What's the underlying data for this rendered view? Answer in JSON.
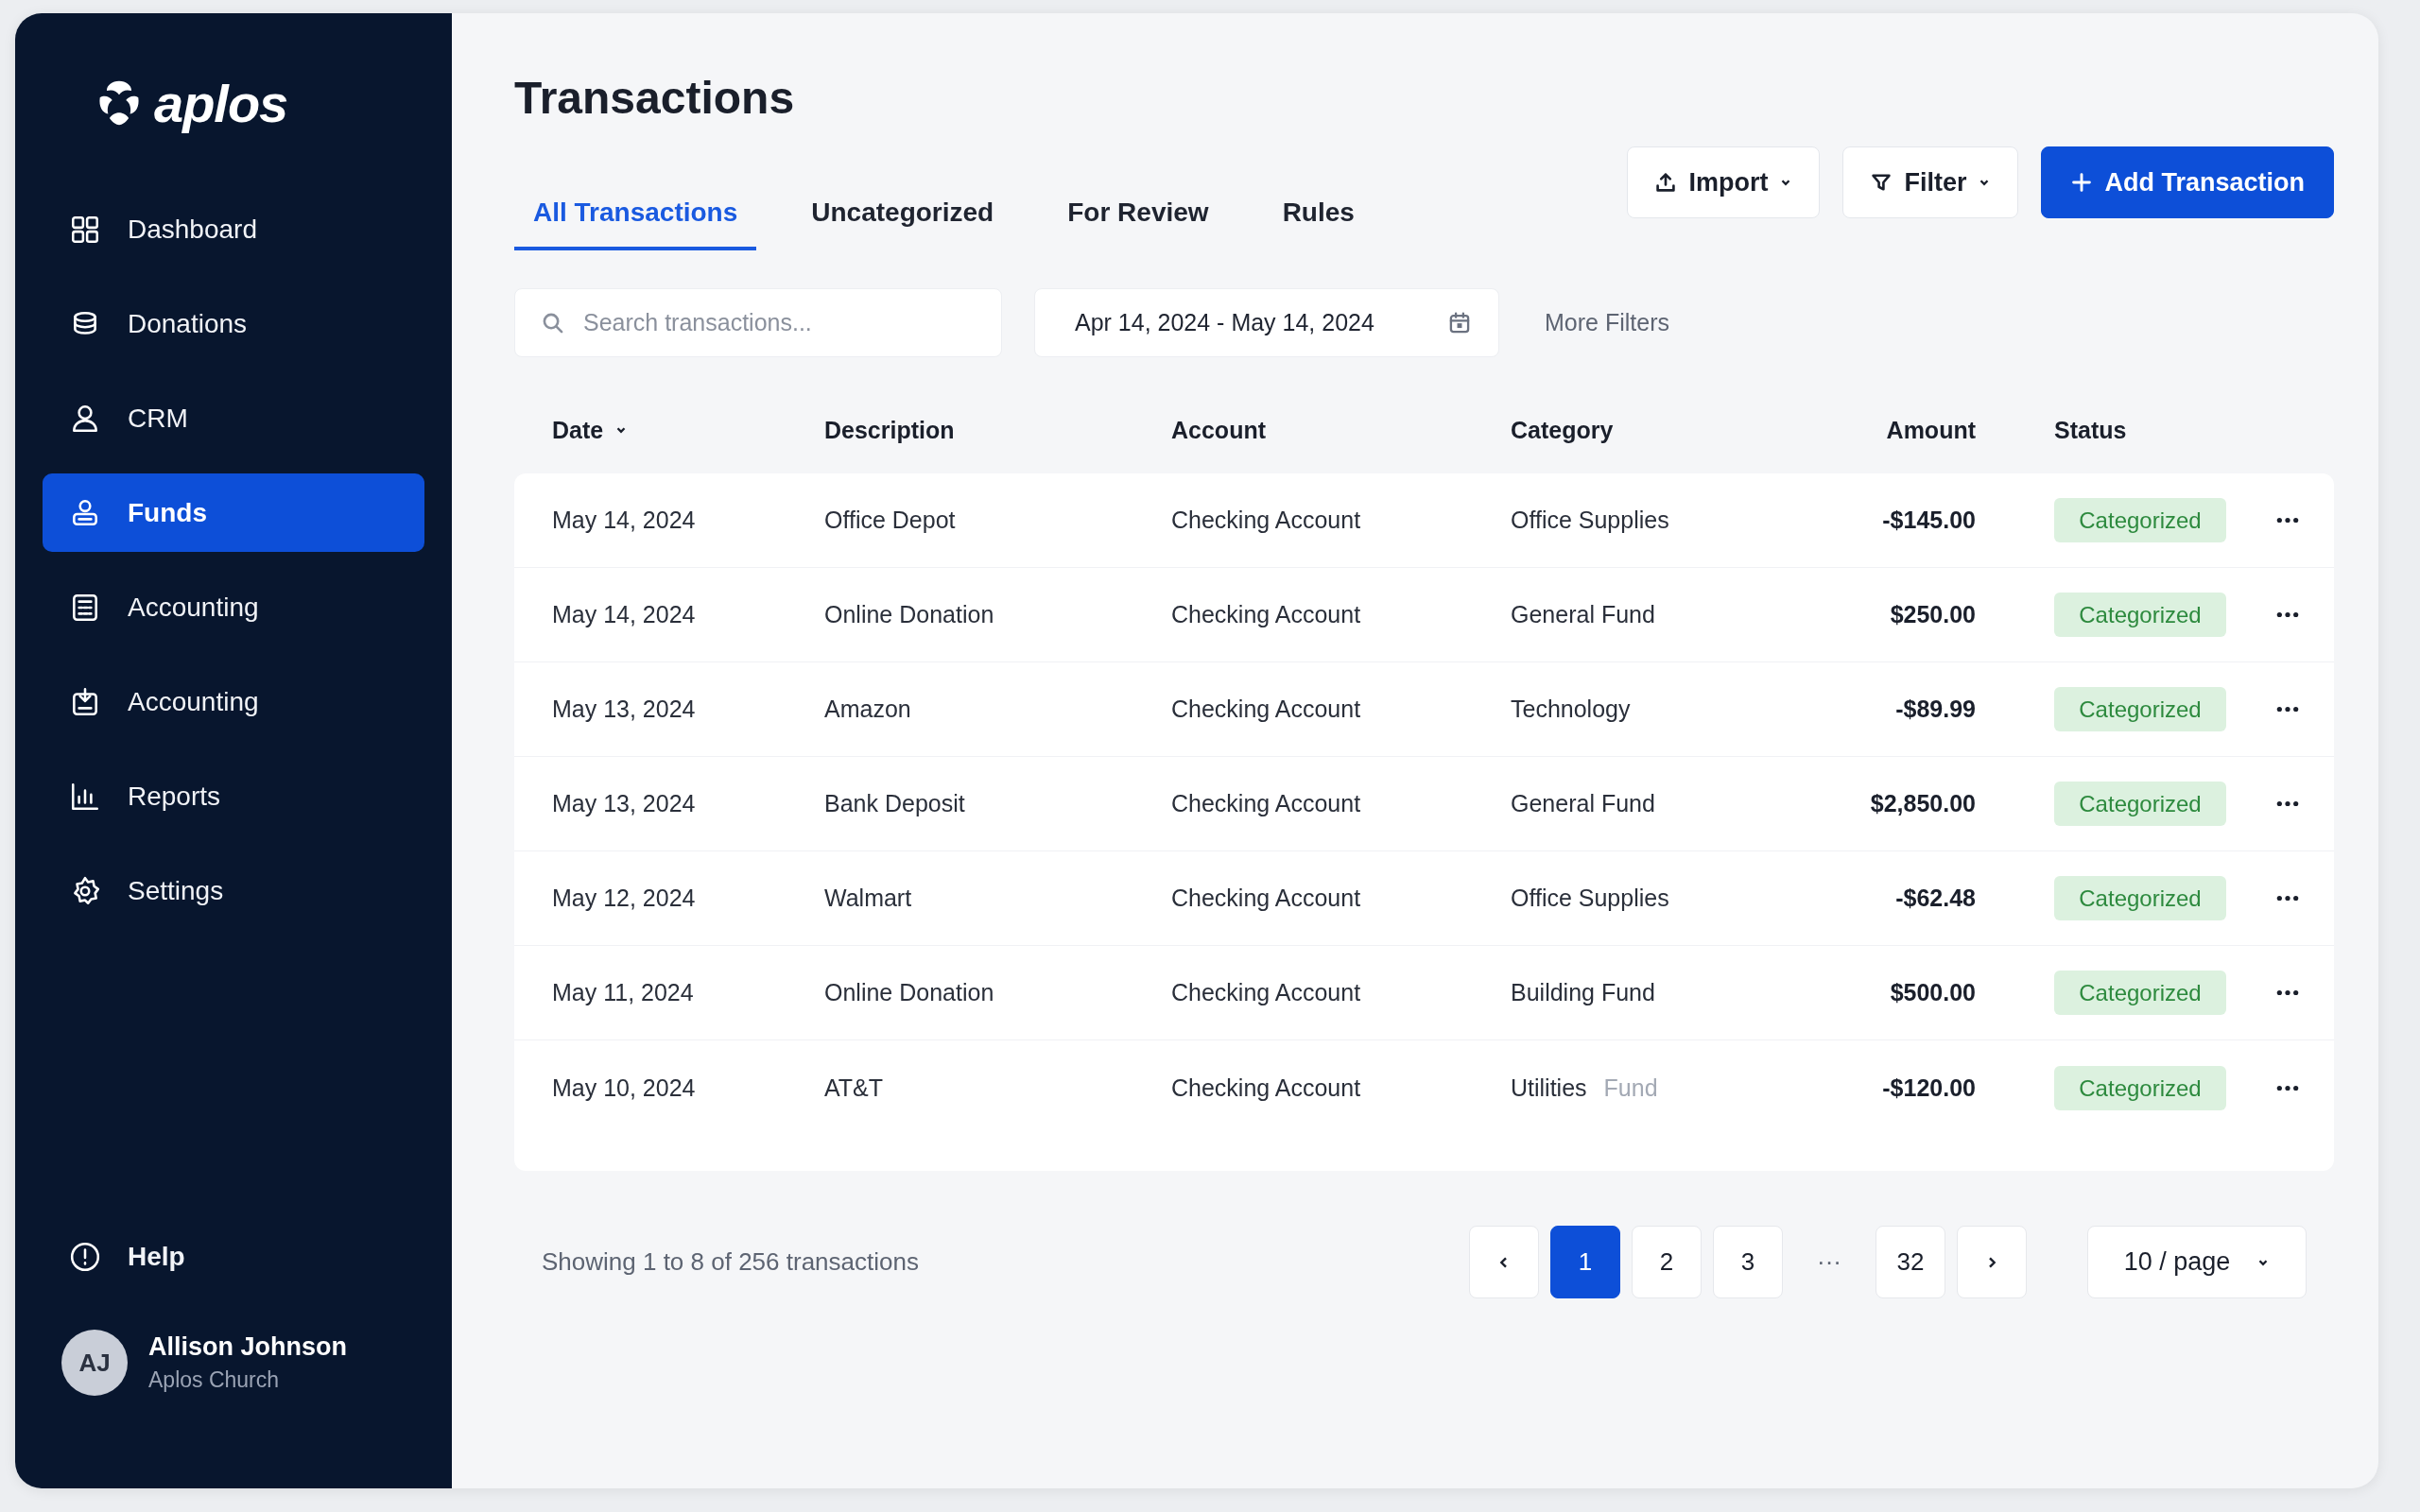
{
  "sidebar": {
    "logo": "aplos",
    "items": [
      {
        "label": "Dashboard",
        "selected": false
      },
      {
        "label": "Donations",
        "selected": false
      },
      {
        "label": "CRM",
        "selected": false
      },
      {
        "label": "Funds",
        "selected": true
      },
      {
        "label": "Accounting",
        "selected": false
      },
      {
        "label": "Accounting",
        "selected": false
      },
      {
        "label": "Reports",
        "selected": false
      },
      {
        "label": "Settings",
        "selected": false
      }
    ],
    "help": "Help",
    "user": {
      "initials": "AJ",
      "name": "Allison Johnson",
      "org": "Aplos Church"
    }
  },
  "title": "Transactions",
  "tabs": [
    {
      "label": "All Transactions",
      "selected": true
    },
    {
      "label": "Uncategorized",
      "selected": false
    },
    {
      "label": "For Review",
      "selected": false
    },
    {
      "label": "Rules",
      "selected": false
    }
  ],
  "actions": {
    "import": "Import",
    "filter": "Filter",
    "add": "Add Transaction"
  },
  "search": {
    "placeholder": "Search transactions..."
  },
  "date_range": "Apr 14, 2024 - May 14, 2024",
  "more_filters": "More Filters",
  "table": {
    "columns": [
      {
        "label": "Date",
        "sorted": true
      },
      {
        "label": "Description",
        "sorted": false
      },
      {
        "label": "Account",
        "sorted": false
      },
      {
        "label": "Category",
        "sorted": false
      },
      {
        "label": "Amount",
        "sorted": false
      },
      {
        "label": "Status",
        "sorted": false
      }
    ],
    "rows": [
      {
        "date": "May 14, 2024",
        "description": "Office Depot",
        "account": "Checking Account",
        "category": "Office Supplies",
        "amount": "-$145.00",
        "status": "Categorized"
      },
      {
        "date": "May 14, 2024",
        "description": "Online Donation",
        "account": "Checking Account",
        "category": "General Fund",
        "amount": "$250.00",
        "status": "Categorized"
      },
      {
        "date": "May 13, 2024",
        "description": "Amazon",
        "account": "Checking Account",
        "category": "Technology",
        "amount": "-$89.99",
        "status": "Categorized"
      },
      {
        "date": "May 13, 2024",
        "description": "Bank Deposit",
        "account": "Checking Account",
        "category": "General Fund",
        "amount": "$2,850.00",
        "status": "Categorized"
      },
      {
        "date": "May 12, 2024",
        "description": "Walmart",
        "account": "Checking Account",
        "category": "Office Supplies",
        "amount": "-$62.48",
        "status": "Categorized"
      },
      {
        "date": "May 11, 2024",
        "description": "Online Donation",
        "account": "Checking Account",
        "category": "Building Fund",
        "amount": "$500.00",
        "status": "Categorized"
      },
      {
        "date": "May 10, 2024",
        "description": "AT&T",
        "account": "Checking Account",
        "category": "Utilities",
        "category_faded": "Fund",
        "amount": "-$120.00",
        "status": "Categorized"
      }
    ]
  },
  "footer": {
    "summary": "Showing 1 to 8 of 256 transactions",
    "pages": [
      {
        "kind": "page",
        "label": "1",
        "selected": true
      },
      {
        "kind": "page",
        "label": "2",
        "selected": false
      },
      {
        "kind": "page",
        "label": "3",
        "selected": false
      },
      {
        "kind": "ellipsis",
        "label": "···"
      },
      {
        "kind": "page",
        "label": "32",
        "selected": false
      }
    ],
    "per_page": "10 / page"
  }
}
